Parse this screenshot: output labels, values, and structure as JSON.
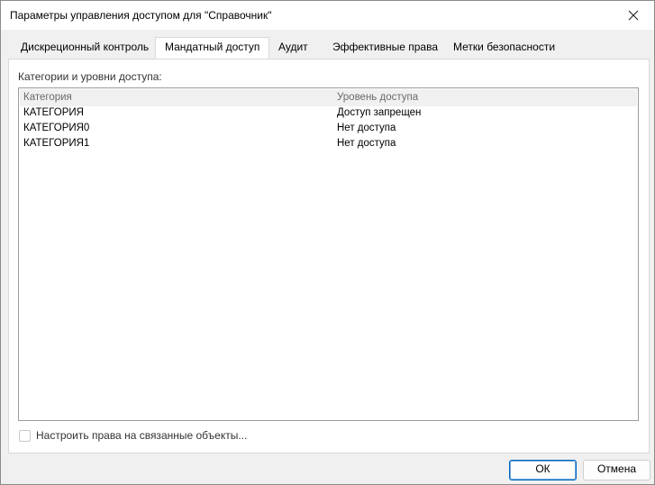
{
  "window": {
    "title": "Параметры управления доступом для \"Справочник\""
  },
  "tabs": [
    {
      "label": "Дискреционный контроль",
      "active": false
    },
    {
      "label": "Мандатный доступ",
      "active": true
    },
    {
      "label": "Аудит",
      "active": false
    },
    {
      "label": "Эффективные права",
      "active": false
    },
    {
      "label": "Метки безопасности",
      "active": false
    }
  ],
  "panel": {
    "group_label": "Категории и уровни доступа:",
    "columns": [
      "Категория",
      "Уровень доступа"
    ],
    "rows": [
      {
        "category": "КАТЕГОРИЯ",
        "level": "Доступ запрещен"
      },
      {
        "category": "КАТЕГОРИЯ0",
        "level": "Нет доступа"
      },
      {
        "category": "КАТЕГОРИЯ1",
        "level": "Нет доступа"
      }
    ],
    "checkbox_label": "Настроить права на связанные объекты...",
    "checkbox_checked": false
  },
  "buttons": {
    "ok": "ОК",
    "cancel": "Отмена"
  }
}
